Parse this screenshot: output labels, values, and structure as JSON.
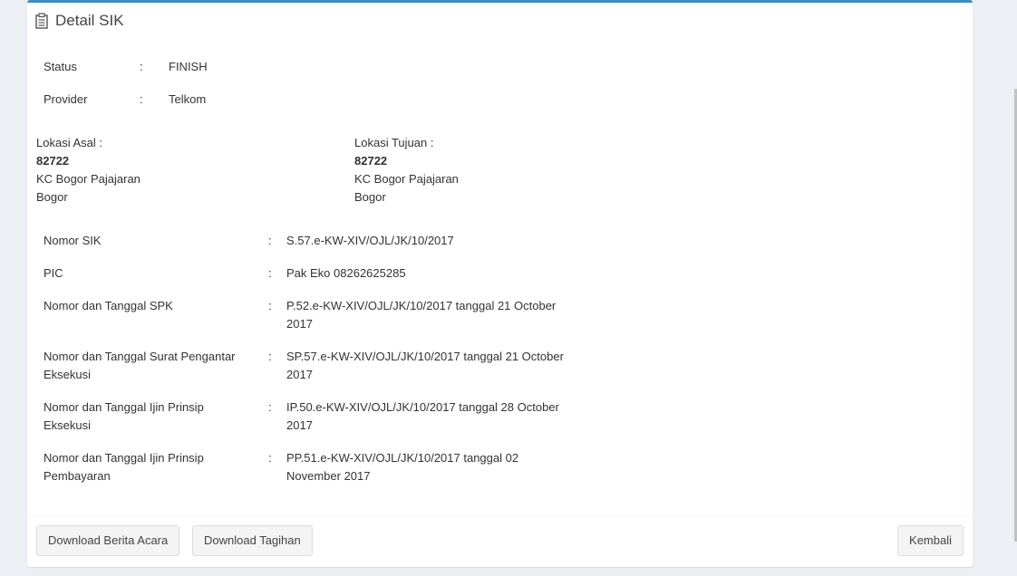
{
  "header": {
    "icon": "clipboard-icon",
    "title": "Detail SIK"
  },
  "status": {
    "label": "Status",
    "sep": ":",
    "value": "FINISH"
  },
  "provider": {
    "label": "Provider",
    "sep": ":",
    "value": "Telkom"
  },
  "lokasi_asal": {
    "label": "Lokasi Asal :",
    "code": "82722",
    "name": "KC Bogor Pajajaran",
    "city": "Bogor"
  },
  "lokasi_tujuan": {
    "label": "Lokasi Tujuan :",
    "code": "82722",
    "name": "KC Bogor Pajajaran",
    "city": "Bogor"
  },
  "details": [
    {
      "label": "Nomor SIK",
      "sep": ":",
      "value": "S.57.e-KW-XIV/OJL/JK/10/2017"
    },
    {
      "label": "PIC",
      "sep": ":",
      "value": "Pak Eko 08262625285"
    },
    {
      "label": "Nomor dan Tanggal SPK",
      "sep": ":",
      "value": "P.52.e-KW-XIV/OJL/JK/10/2017 tanggal 21 October 2017"
    },
    {
      "label": "Nomor dan Tanggal Surat Pengantar Eksekusi",
      "sep": ":",
      "value": "SP.57.e-KW-XIV/OJL/JK/10/2017 tanggal 21 October 2017"
    },
    {
      "label": "Nomor dan Tanggal Ijin Prinsip Eksekusi",
      "sep": ":",
      "value": "IP.50.e-KW-XIV/OJL/JK/10/2017 tanggal 28 October 2017"
    },
    {
      "label": "Nomor dan Tanggal Ijin Prinsip Pembayaran",
      "sep": ":",
      "value": "PP.51.e-KW-XIV/OJL/JK/10/2017 tanggal 02 November 2017"
    }
  ],
  "footer": {
    "download_berita_acara": "Download Berita Acara",
    "download_tagihan": "Download Tagihan",
    "kembali": "Kembali"
  },
  "colors": {
    "accent": "#3c8dbc",
    "background": "#ecf0f5",
    "button_bg": "#f4f4f4"
  }
}
